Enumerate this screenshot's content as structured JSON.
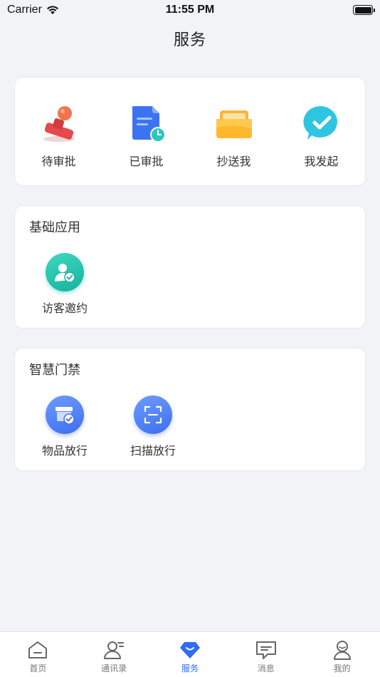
{
  "status": {
    "carrier": "Carrier",
    "time": "11:55 PM"
  },
  "page_title": "服务",
  "approvals": [
    {
      "label": "待审批",
      "icon": "stamp-icon"
    },
    {
      "label": "已审批",
      "icon": "document-clock-icon"
    },
    {
      "label": "抄送我",
      "icon": "folder-icon"
    },
    {
      "label": "我发起",
      "icon": "chat-check-icon"
    }
  ],
  "basic_apps": {
    "title": "基础应用",
    "items": [
      {
        "label": "访客邀约",
        "icon": "visitor-icon"
      }
    ]
  },
  "smart_gate": {
    "title": "智慧门禁",
    "items": [
      {
        "label": "物品放行",
        "icon": "package-check-icon"
      },
      {
        "label": "扫描放行",
        "icon": "scan-icon"
      }
    ]
  },
  "tabs": [
    {
      "label": "首页",
      "icon": "home-icon"
    },
    {
      "label": "通讯录",
      "icon": "contacts-icon"
    },
    {
      "label": "服务",
      "icon": "diamond-icon",
      "active": true
    },
    {
      "label": "消息",
      "icon": "message-icon"
    },
    {
      "label": "我的",
      "icon": "user-icon"
    }
  ],
  "colors": {
    "accent": "#2f6cf6",
    "background": "#f2f3f7",
    "teal": "#1fc2a8"
  }
}
